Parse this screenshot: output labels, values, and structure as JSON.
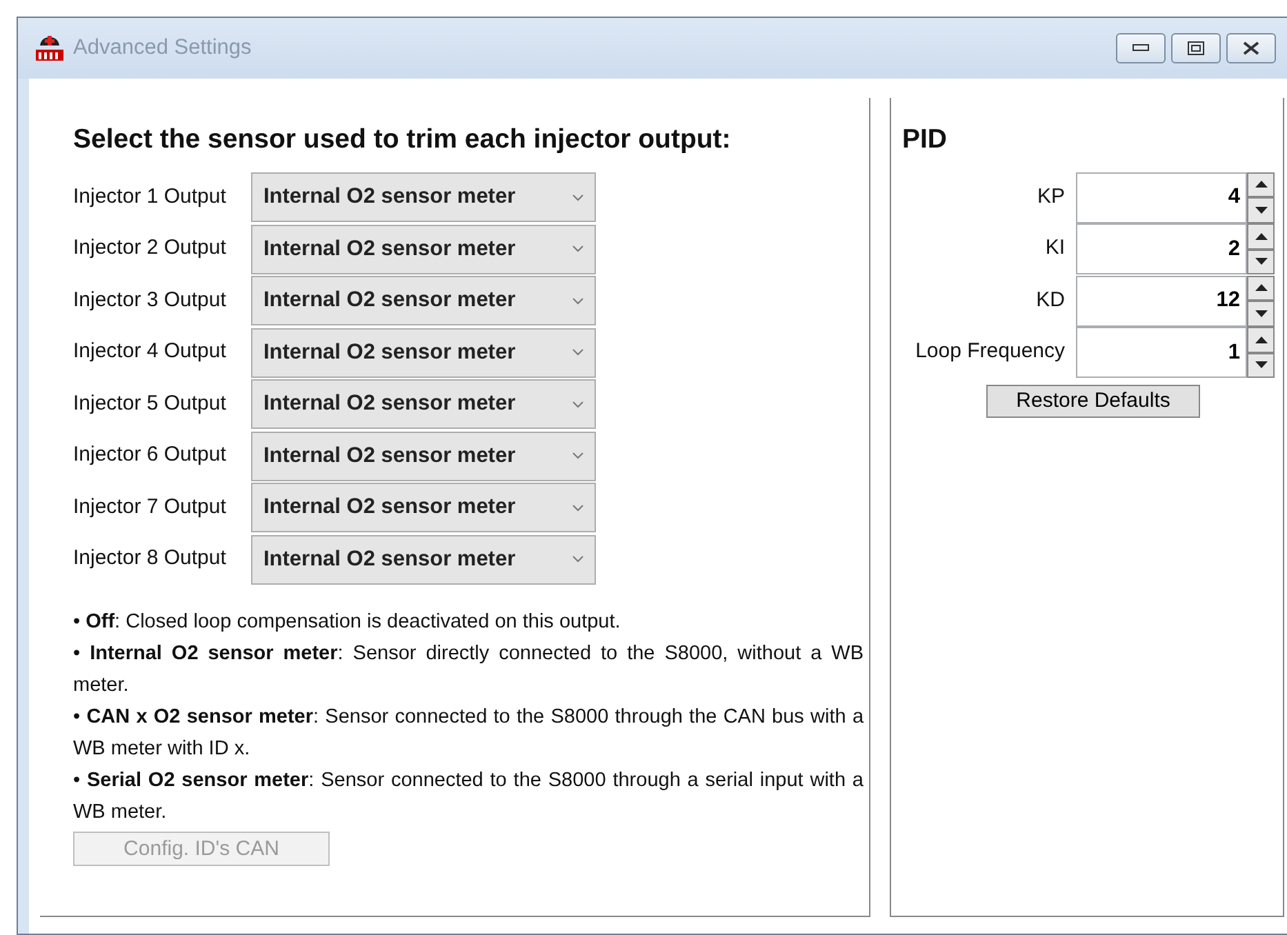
{
  "window": {
    "title": "Advanced Settings"
  },
  "sensor_panel": {
    "heading": "Select the sensor used to trim each injector output:",
    "injectors": [
      {
        "label": "Injector 1 Output",
        "value": "Internal O2 sensor meter"
      },
      {
        "label": "Injector 2 Output",
        "value": "Internal O2 sensor meter"
      },
      {
        "label": "Injector 3 Output",
        "value": "Internal O2 sensor meter"
      },
      {
        "label": "Injector 4 Output",
        "value": "Internal O2 sensor meter"
      },
      {
        "label": "Injector 5 Output",
        "value": "Internal O2 sensor meter"
      },
      {
        "label": "Injector 6 Output",
        "value": "Internal O2 sensor meter"
      },
      {
        "label": "Injector 7 Output",
        "value": "Internal O2 sensor meter"
      },
      {
        "label": "Injector 8 Output",
        "value": "Internal O2 sensor meter"
      }
    ],
    "descriptions": [
      "• **Off**: Closed loop compensation is deactivated on this output.",
      "• **Internal O2 sensor meter**: Sensor directly connected to the S8000, without a WB meter.",
      "• **CAN x O2 sensor meter**: Sensor connected to the S8000 through the CAN bus with a WB meter with ID x.",
      "• **Serial O2 sensor meter**: Sensor connected to the S8000 through a serial input with a WB meter."
    ],
    "config_button": {
      "label": "Config. ID's CAN",
      "disabled": true
    }
  },
  "pid_panel": {
    "heading": "PID",
    "fields": [
      {
        "label": "KP",
        "value": "4"
      },
      {
        "label": "KI",
        "value": "2"
      },
      {
        "label": "KD",
        "value": "12"
      },
      {
        "label": "Loop Frequency",
        "value": "1"
      }
    ],
    "restore_button": {
      "label": "Restore Defaults"
    }
  }
}
